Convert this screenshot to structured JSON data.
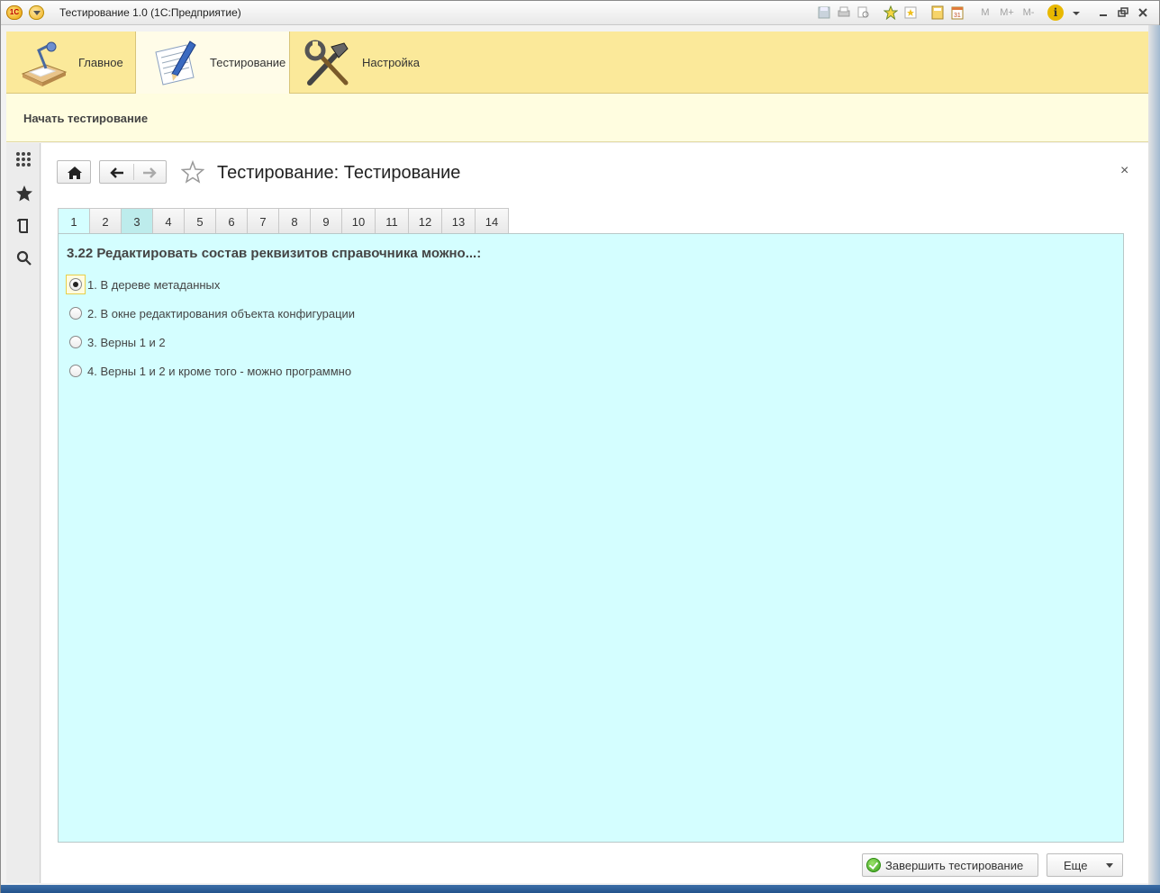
{
  "window": {
    "title": "Тестирование 1.0  (1С:Предприятие)",
    "logo_text": "1С",
    "tools": [
      "M",
      "M+",
      "M-"
    ]
  },
  "sections": [
    {
      "label": "Главное",
      "icon": "desk-lamp-icon"
    },
    {
      "label": "Тестирование",
      "icon": "notepad-pencil-icon"
    },
    {
      "label": "Настройка",
      "icon": "tools-icon"
    }
  ],
  "function_panel": {
    "command": "Начать тестирование"
  },
  "form": {
    "title": "Тестирование: Тестирование",
    "close": "×"
  },
  "tabs": [
    "1",
    "2",
    "3",
    "4",
    "5",
    "6",
    "7",
    "8",
    "9",
    "10",
    "11",
    "12",
    "13",
    "14"
  ],
  "active_tab": "1",
  "question": {
    "text": "3.22 Редактировать состав реквизитов справочника можно...:",
    "answers": [
      {
        "label": "1. В дереве метаданных",
        "selected": true
      },
      {
        "label": "2. В окне редактирования объекта конфигурации",
        "selected": false
      },
      {
        "label": "3. Верны 1 и 2",
        "selected": false
      },
      {
        "label": "4. Верны 1 и 2 и кроме того - можно программно",
        "selected": false
      }
    ]
  },
  "buttons": {
    "finish": "Завершить тестирование",
    "more": "Еще"
  },
  "colors": {
    "section_panel": "#fbe99a",
    "function_panel": "#fffde0",
    "tab_body": "#d4feff"
  }
}
